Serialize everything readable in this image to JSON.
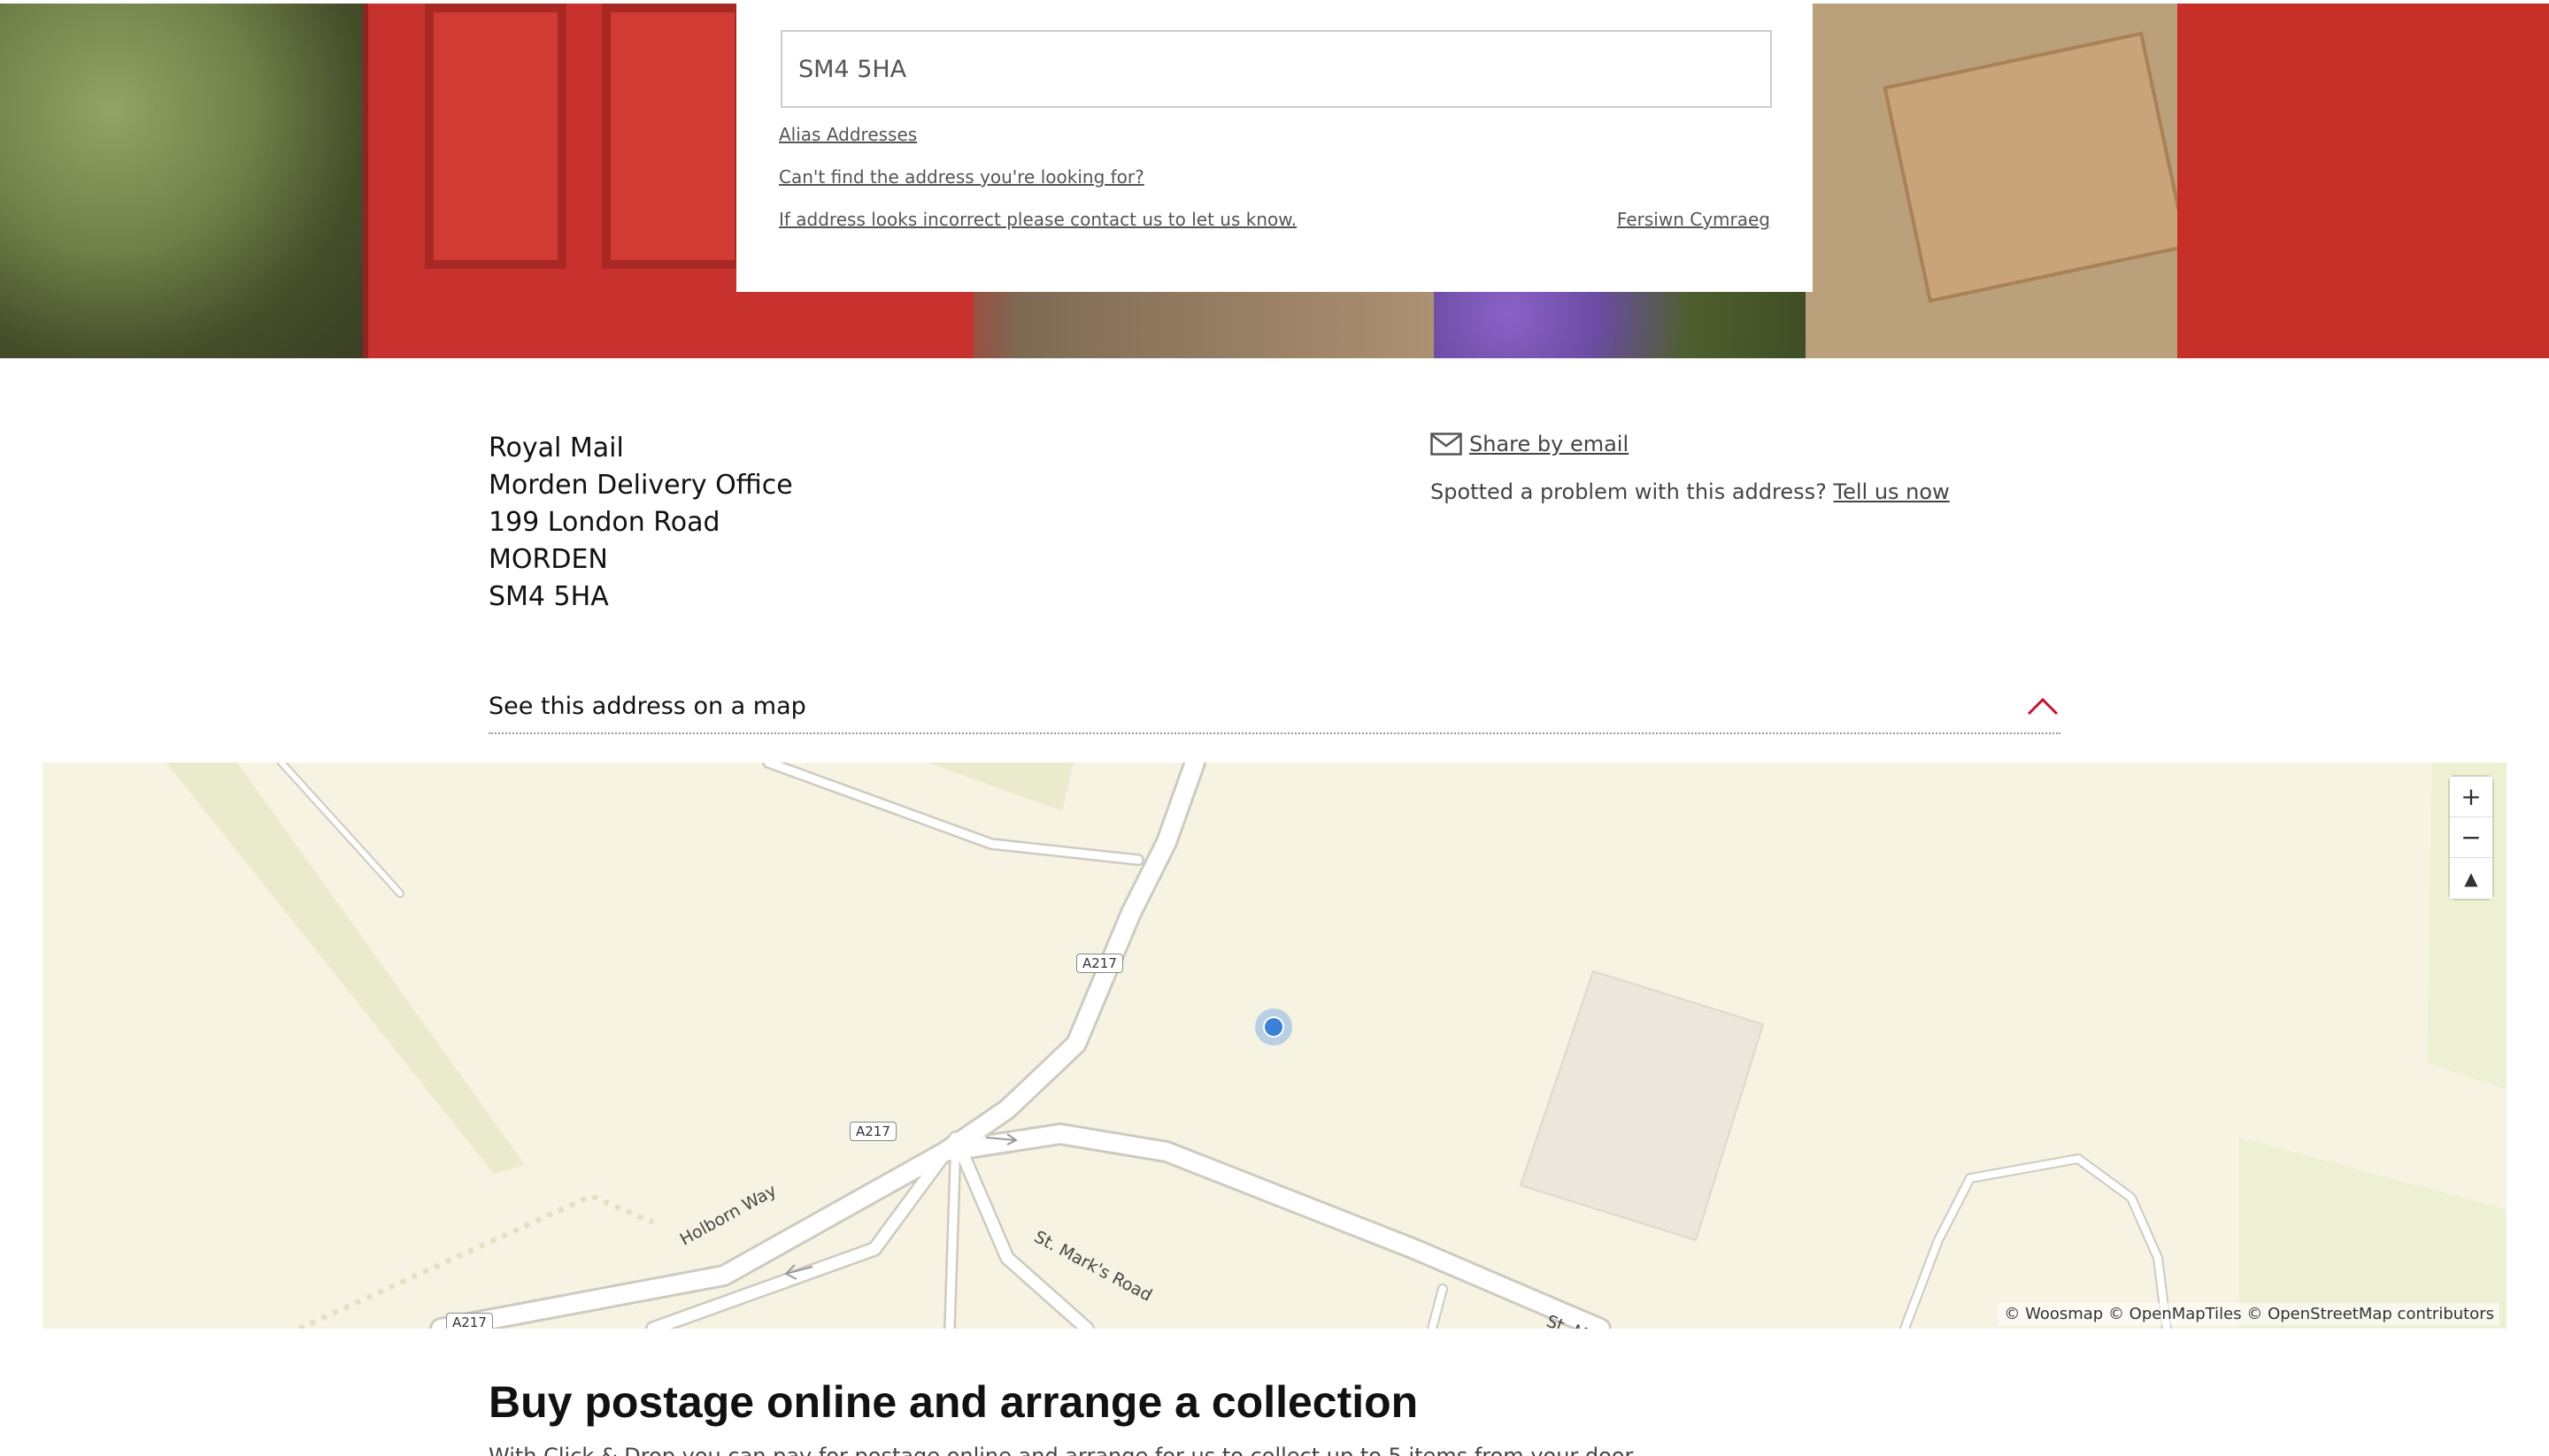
{
  "search": {
    "postcode_value": "SM4 5HA",
    "alias_link": "Alias Addresses",
    "cant_find_link": "Can't find the address you're looking for?",
    "incorrect_link": "If address looks incorrect please contact us to let us know.",
    "welsh_link": "Fersiwn Cymraeg"
  },
  "address": {
    "lines": [
      "Royal Mail",
      "Morden Delivery Office",
      "199 London Road",
      "MORDEN",
      "SM4 5HA"
    ]
  },
  "share": {
    "label": "Share by email",
    "problem_text": "Spotted a problem with this address?",
    "tell_us_link": "Tell us now"
  },
  "map_section": {
    "toggle_label": "See this address on a map",
    "road_shields": [
      "A217",
      "A217",
      "A217"
    ],
    "street_names": [
      "Holborn Way",
      "St. Mark's Road",
      "St. M"
    ],
    "zoom_in": "+",
    "zoom_out": "−",
    "reset_north": "▲",
    "attribution": "© Woosmap © OpenMapTiles © OpenStreetMap contributors"
  },
  "promo": {
    "title": "Buy postage online and arrange a collection",
    "subtitle": "With Click & Drop you can pay for postage online and arrange for us to collect up to 5 items from your door"
  },
  "colors": {
    "accent_red": "#c8102e",
    "pin_blue": "#3a7fd8",
    "map_bg": "#f7f3e2"
  }
}
